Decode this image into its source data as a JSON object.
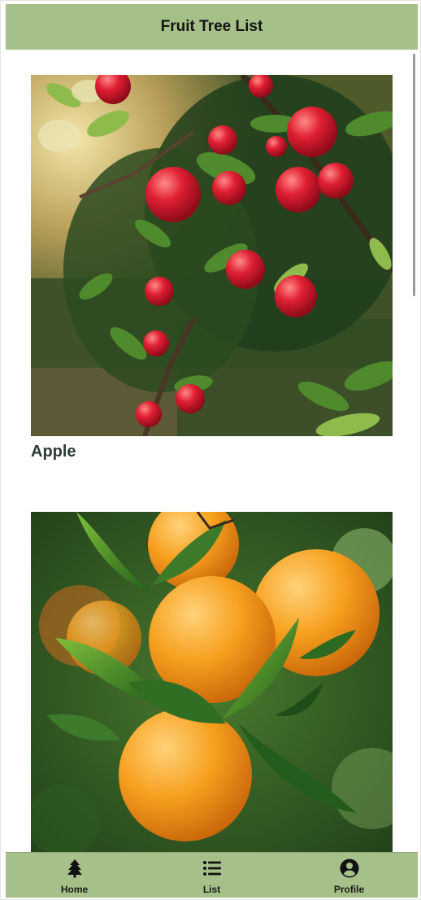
{
  "header": {
    "title": "Fruit Tree List"
  },
  "items": [
    {
      "name": "Apple",
      "image": "apple-tree-photo"
    },
    {
      "name": "",
      "image": "orange-tree-photo"
    }
  ],
  "tabs": [
    {
      "label": "Home",
      "icon": "tree-icon"
    },
    {
      "label": "List",
      "icon": "list-icon"
    },
    {
      "label": "Profile",
      "icon": "profile-icon"
    }
  ],
  "colors": {
    "header_bg": "#a5c089",
    "tabbar_bg": "#a5c089",
    "item_text": "#2d3b36"
  }
}
